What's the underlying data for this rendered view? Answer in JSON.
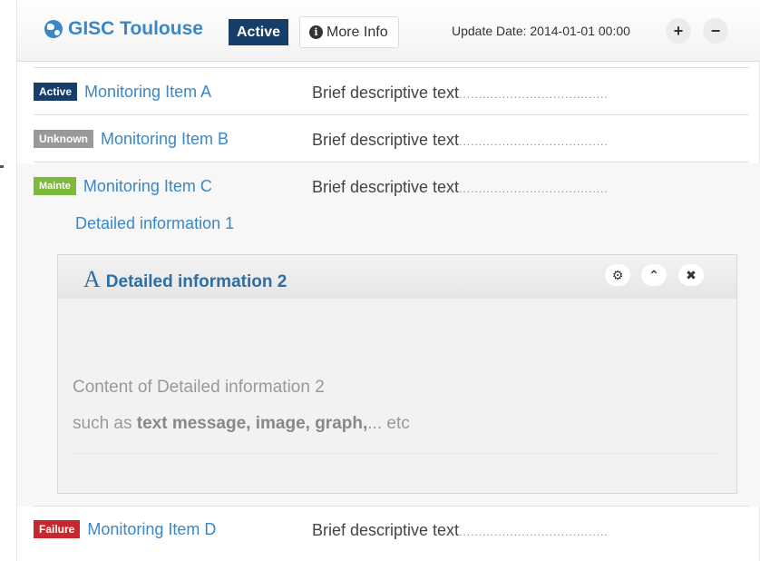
{
  "header": {
    "title": "GISC Toulouse",
    "status": "Active",
    "more_info_label": "More Info",
    "update_date": "Update Date: 2014-01-01 00:00",
    "plus_label": "+",
    "minus_label": "−"
  },
  "items": [
    {
      "status": "Active",
      "name": "Monitoring Item A",
      "description": "Brief descriptive text",
      "dots": "......................................"
    },
    {
      "status": "Unknown",
      "name": "Monitoring Item B",
      "description": "Brief descriptive text",
      "dots": "......................................"
    },
    {
      "status": "Mainte",
      "name": "Monitoring Item C",
      "description": "Brief descriptive text",
      "dots": "......................................"
    },
    {
      "status": "Failure",
      "name": "Monitoring Item D",
      "description": "Brief descriptive text",
      "dots": "......................................"
    }
  ],
  "detail": {
    "link_1": "Detailed information 1",
    "panel_title": "Detailed information 2",
    "font_icon": "A",
    "content_line_1": "Content of Detailed information 2",
    "content_prefix": "such as ",
    "content_bold": "text message, image, graph,",
    "content_suffix": "... etc",
    "tools": {
      "settings": "⚙",
      "collapse": "⌃",
      "close": "✖"
    }
  },
  "colors": {
    "accent": "#3a87c8",
    "active": "#153e6b",
    "unknown": "#999999",
    "mainte": "#7dba3c",
    "failure": "#c8272e"
  }
}
